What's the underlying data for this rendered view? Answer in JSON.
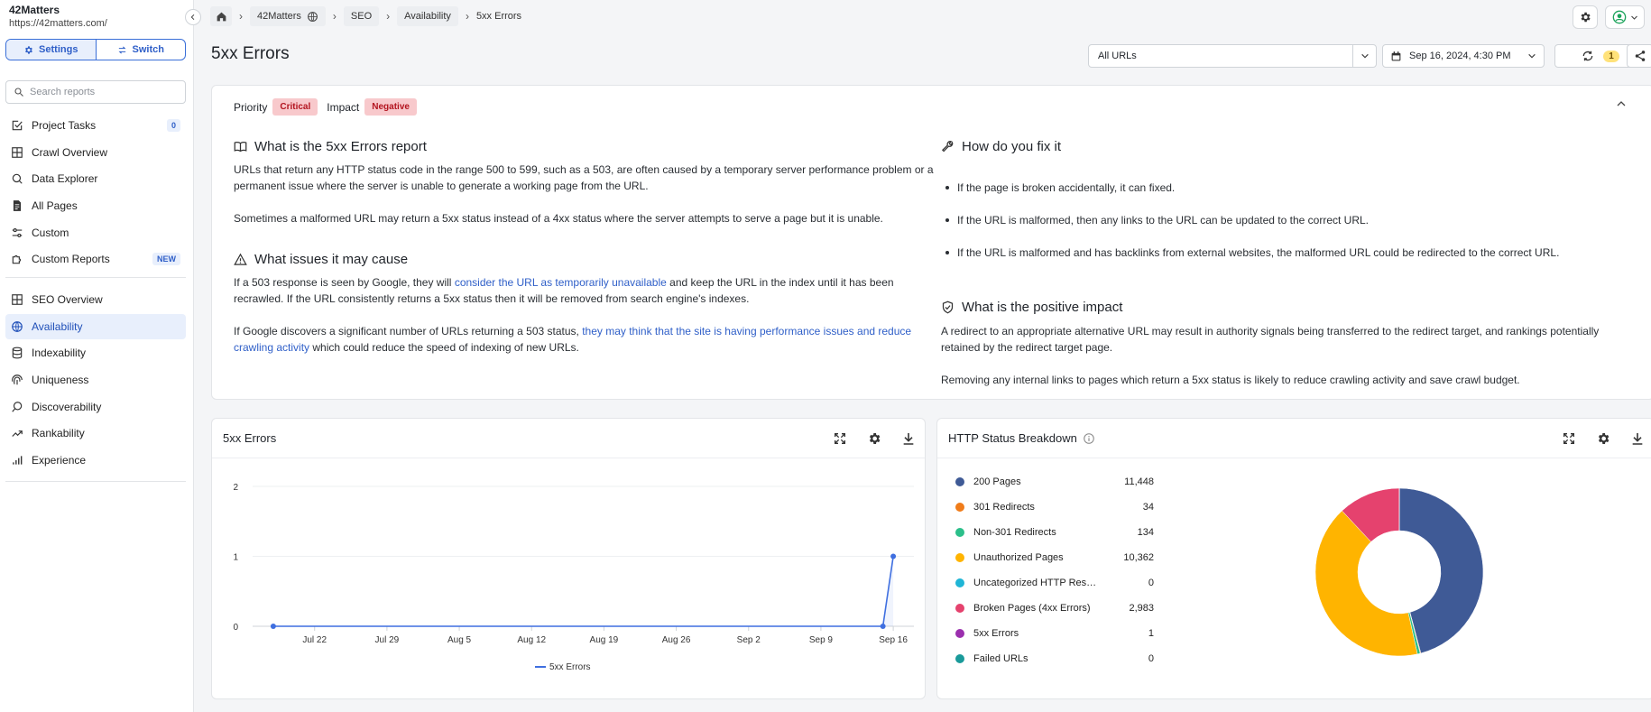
{
  "project": {
    "name": "42Matters",
    "url": "https://42matters.com/"
  },
  "sidebar": {
    "settings_label": "Settings",
    "switch_label": "Switch",
    "search_placeholder": "Search reports",
    "group1": [
      {
        "label": "Project Tasks",
        "icon": "checkbox-icon",
        "badge": "0"
      },
      {
        "label": "Crawl Overview",
        "icon": "grid-icon"
      },
      {
        "label": "Data Explorer",
        "icon": "magnifier-icon"
      },
      {
        "label": "All Pages",
        "icon": "document-icon"
      },
      {
        "label": "Custom",
        "icon": "sliders-icon"
      },
      {
        "label": "Custom Reports",
        "icon": "puzzle-icon",
        "badge": "NEW"
      }
    ],
    "group2": [
      {
        "label": "SEO Overview",
        "icon": "grid-icon"
      },
      {
        "label": "Availability",
        "icon": "globe-icon",
        "active": true
      },
      {
        "label": "Indexability",
        "icon": "database-icon"
      },
      {
        "label": "Uniqueness",
        "icon": "fingerprint-icon"
      },
      {
        "label": "Discoverability",
        "icon": "search-icon"
      },
      {
        "label": "Rankability",
        "icon": "trend-up-icon"
      },
      {
        "label": "Experience",
        "icon": "bars-icon"
      }
    ]
  },
  "breadcrumb": {
    "project": "42Matters",
    "section": "SEO",
    "category": "Availability",
    "current": "5xx Errors"
  },
  "page": {
    "title": "5xx Errors"
  },
  "filters": {
    "url_filter": "All URLs",
    "date": "Sep 16, 2024, 4:30 PM",
    "refresh_count": "1"
  },
  "info": {
    "priority_label": "Priority",
    "priority_value": "Critical",
    "impact_label": "Impact",
    "impact_value": "Negative",
    "what_title": "What is the 5xx Errors report",
    "what_p1": "URLs that return any HTTP status code in the range 500 to 599, such as a 503, are often caused by a temporary server performance problem or a permanent issue where the server is unable to generate a working page from the URL.",
    "what_p2": "Sometimes a malformed URL may return a 5xx status instead of a 4xx status where the server attempts to serve a page but it is unable.",
    "issues_title": "What issues it may cause",
    "issues_p1_a": "If a 503 response is seen by Google, they will ",
    "issues_p1_link": "consider the URL as temporarily unavailable",
    "issues_p1_b": " and keep the URL in the index until it has been recrawled. If the URL consistently returns a 5xx status then it will be removed from search engine's indexes.",
    "issues_p2_a": "If Google discovers a significant number of URLs returning a 503 status, ",
    "issues_p2_link": "they may think that the site is having performance issues and reduce crawling activity",
    "issues_p2_b": " which could reduce the speed of indexing of new URLs.",
    "fix_title": "How do you fix it",
    "fix_items": [
      "If the page is broken accidentally, it can fixed.",
      "If the URL is malformed, then any links to the URL can be updated to the correct URL.",
      "If the URL is malformed and has backlinks from external websites, the malformed URL could be redirected to the correct URL."
    ],
    "positive_title": "What is the positive impact",
    "positive_p1": "A redirect to an appropriate alternative URL may result in authority signals being transferred to the redirect target, and rankings potentially retained by the redirect target page.",
    "positive_p2": "Removing any internal links to pages which return a 5xx status is likely to reduce crawling activity and save crawl budget."
  },
  "line_card": {
    "title": "5xx Errors"
  },
  "pie_card": {
    "title": "HTTP Status Breakdown"
  },
  "chart_data": [
    {
      "type": "line",
      "title": "5xx Errors",
      "x_tick_labels": [
        "Jul 22",
        "Jul 29",
        "Aug 5",
        "Aug 12",
        "Aug 19",
        "Aug 26",
        "Sep 2",
        "Sep 9",
        "Sep 16"
      ],
      "y_ticks": [
        0,
        1,
        2
      ],
      "ylim": [
        0,
        2
      ],
      "xlim": [
        "2024-07-16",
        "2024-09-18"
      ],
      "series": [
        {
          "name": "5xx Errors",
          "color": "#3f6fe0",
          "points": [
            {
              "x": "2024-07-18",
              "y": 0
            },
            {
              "x": "2024-09-15",
              "y": 0
            },
            {
              "x": "2024-09-16",
              "y": 1
            }
          ]
        }
      ],
      "legend": "bottom",
      "grid": true
    },
    {
      "type": "pie",
      "title": "HTTP Status Breakdown",
      "legend": "left",
      "slices": [
        {
          "label": "200 Pages",
          "value": 11448,
          "display": "11,448",
          "color": "#3f5a96"
        },
        {
          "label": "301 Redirects",
          "value": 34,
          "display": "34",
          "color": "#f07c1a"
        },
        {
          "label": "Non-301 Redirects",
          "value": 134,
          "display": "134",
          "color": "#2bbf8a"
        },
        {
          "label": "Unauthorized Pages",
          "value": 10362,
          "display": "10,362",
          "color": "#ffb400"
        },
        {
          "label": "Uncategorized HTTP Response Codes",
          "value": 0,
          "display": "0",
          "color": "#1fb5d6"
        },
        {
          "label": "Broken Pages (4xx Errors)",
          "value": 2983,
          "display": "2,983",
          "color": "#e5426e"
        },
        {
          "label": "5xx Errors",
          "value": 1,
          "display": "1",
          "color": "#9b2fae"
        },
        {
          "label": "Failed URLs",
          "value": 0,
          "display": "0",
          "color": "#1a9a9a"
        }
      ]
    }
  ]
}
